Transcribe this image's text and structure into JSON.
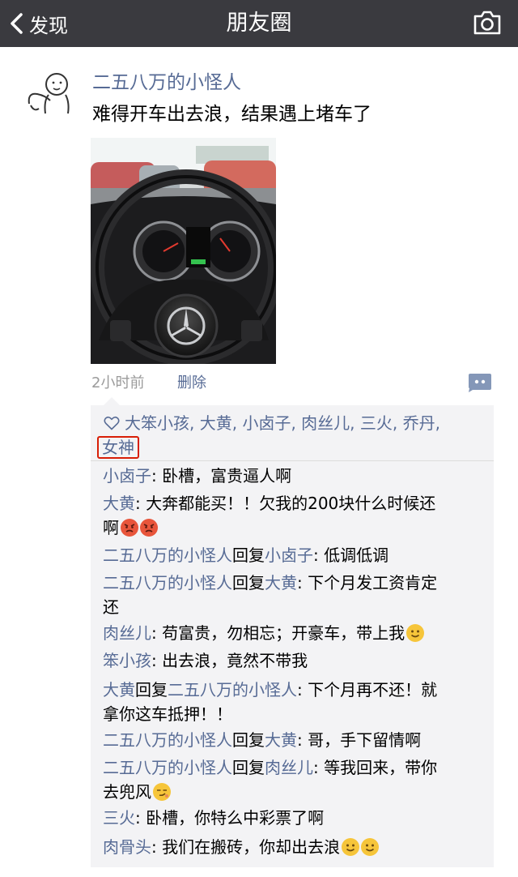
{
  "nav": {
    "back_label": "发现",
    "title": "朋友圈"
  },
  "post": {
    "author": "二五八万的小怪人",
    "text": "难得开车出去浪，结果遇上堵车了",
    "time": "2小时前",
    "delete_label": "删除"
  },
  "likes": {
    "names": [
      "大笨小孩",
      "大黄",
      "小卤子",
      "肉丝儿",
      "三火",
      "乔丹"
    ],
    "sep": ", ",
    "highlighted": "女神"
  },
  "comments": [
    {
      "name": "小卤子",
      "text": ": 卧槽，富贵逼人啊"
    },
    {
      "name": "大黄",
      "text": ": 大奔都能买！！欠我的200块什么时候还",
      "text2": "啊",
      "emoji": "angry-angry"
    },
    {
      "name": "二五八万的小怪人",
      "reply_word": "回复",
      "reply_to": "小卤子",
      "text": ": 低调低调"
    },
    {
      "name": "二五八万的小怪人",
      "reply_word": "回复",
      "reply_to": "大黄",
      "text": ": 下个月发工资肯定",
      "text2": "还"
    },
    {
      "name": "肉丝儿",
      "text": ": 苟富贵，勿相忘；开豪车，带上我",
      "emoji": "smile"
    },
    {
      "name": "笨小孩",
      "text": ": 出去浪，竟然不带我"
    },
    {
      "name": "大黄",
      "reply_word": "回复",
      "reply_to": "二五八万的小怪人",
      "text": ": 下个月再不还！就",
      "text2": "拿你这车抵押！！"
    },
    {
      "name": "二五八万的小怪人",
      "reply_word": "回复",
      "reply_to": "大黄",
      "text": ": 哥，手下留情啊"
    },
    {
      "name": "二五八万的小怪人",
      "reply_word": "回复",
      "reply_to": "肉丝儿",
      "text": ": 等我回来，带你",
      "text2": "去兜风",
      "emoji": "smirk"
    },
    {
      "name": "三火",
      "text": ": 卧槽，你特么中彩票了啊"
    },
    {
      "name": "肉骨头",
      "text": ": 我们在搬砖，你却出去浪",
      "emoji": "smile-smile"
    }
  ],
  "icons": {
    "back": "chevron-left-icon",
    "camera": "camera-icon",
    "heart": "heart-outline-icon",
    "comment": "comment-bubble-icon"
  },
  "colors": {
    "nav_bg": "#3a3a3f",
    "link": "#576b95",
    "box_bg": "#f3f3f5",
    "highlight_border": "#d81e06"
  }
}
